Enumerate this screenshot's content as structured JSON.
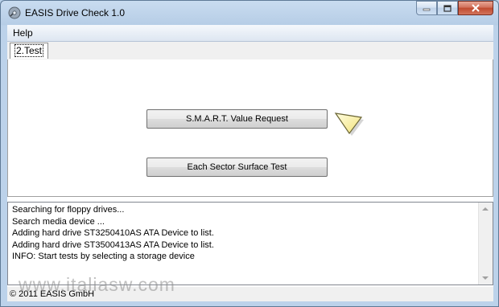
{
  "window": {
    "title": "EASIS Drive Check 1.0"
  },
  "menu": {
    "items": [
      "Help"
    ]
  },
  "tabs": [
    {
      "label": "2.Test",
      "selected": true
    }
  ],
  "panel": {
    "smart_button": "S.M.A.R.T. Value Request",
    "surface_button": "Each Sector Surface Test"
  },
  "log": {
    "lines": [
      "Searching for floppy drives...",
      "Search media device ...",
      "Adding hard drive ST3250410AS ATA Device to list.",
      "Adding hard drive ST3500413AS ATA Device to list.",
      "INFO: Start tests by selecting a storage device"
    ]
  },
  "status": {
    "text": "© 2011 EASIS GmbH"
  },
  "watermark": {
    "text": "www.italiasw.com"
  },
  "icons": {
    "app": "drive-check-icon",
    "pointer": "arrow-pointer-icon"
  }
}
